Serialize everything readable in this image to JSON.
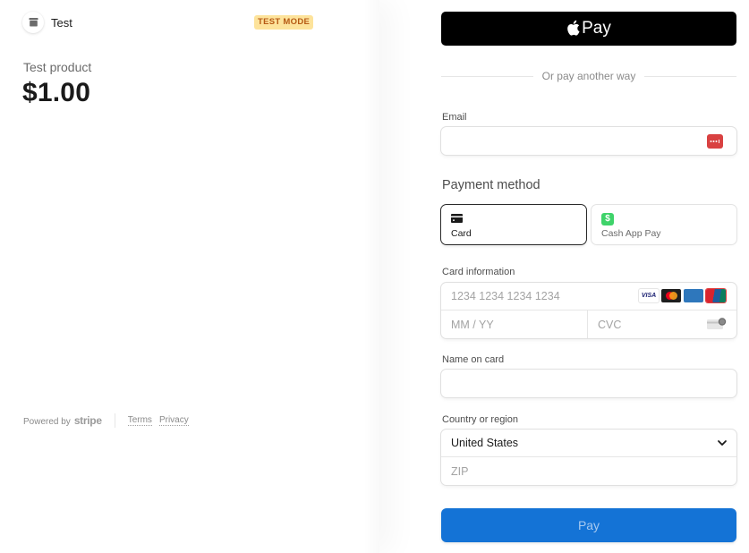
{
  "merchant": {
    "name": "Test",
    "icon": "store-icon",
    "badge": "TEST MODE"
  },
  "product": {
    "name": "Test product",
    "price": "$1.00"
  },
  "footer": {
    "powered_by": "Powered by",
    "brand": "stripe",
    "links": [
      "Terms",
      "Privacy"
    ]
  },
  "checkout": {
    "apple_pay_label": "Pay",
    "divider_text": "Or pay another way",
    "email": {
      "label": "Email",
      "value": "",
      "placeholder": ""
    },
    "payment_method": {
      "title": "Payment method",
      "options": [
        {
          "label": "Card",
          "icon": "card-icon",
          "selected": true
        },
        {
          "label": "Cash App Pay",
          "icon": "cash-app-icon",
          "selected": false
        }
      ]
    },
    "card_info": {
      "label": "Card information",
      "number_placeholder": "1234 1234 1234 1234",
      "expiry_placeholder": "MM / YY",
      "cvc_placeholder": "CVC",
      "brands": [
        "VISA",
        "Mastercard",
        "American Express",
        "UnionPay"
      ]
    },
    "name_on_card": {
      "label": "Name on card",
      "value": ""
    },
    "country": {
      "label": "Country or region",
      "selected": "United States",
      "zip_placeholder": "ZIP"
    },
    "pay_button_label": "Pay"
  },
  "colors": {
    "pay_button": "#1473d6",
    "badge_bg": "#fde39b",
    "badge_text": "#b65a14",
    "cash_app": "#3fd36a"
  }
}
